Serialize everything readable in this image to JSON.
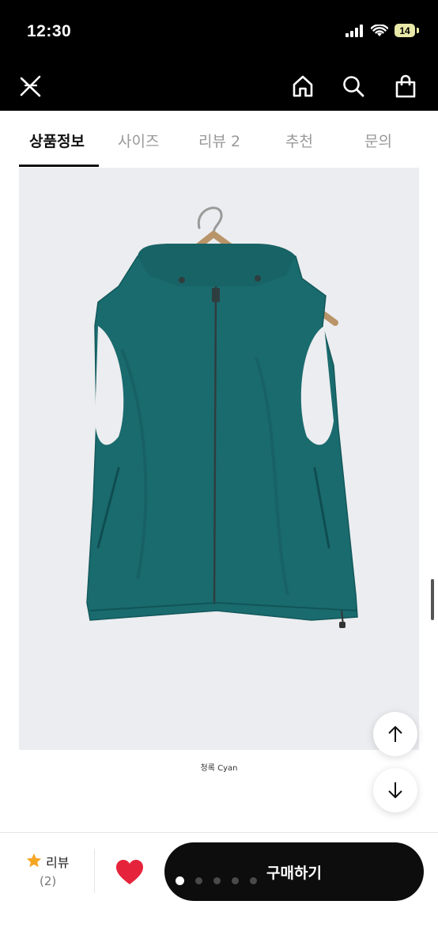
{
  "status": {
    "time": "12:30",
    "battery": "14"
  },
  "tabs": [
    {
      "label": "상품정보",
      "active": true
    },
    {
      "label": "사이즈",
      "active": false
    },
    {
      "label": "리뷰 2",
      "active": false
    },
    {
      "label": "추천",
      "active": false
    },
    {
      "label": "문의",
      "active": false
    }
  ],
  "product": {
    "caption": "청록 Cyan",
    "color_hex": "#1a6b6e"
  },
  "bottom": {
    "review_label": "리뷰",
    "review_count": "(2)",
    "buy_label": "구매하기"
  },
  "carousel": {
    "total_pages": 5,
    "current_page": 1
  },
  "colors": {
    "accent": "#0d0d0d",
    "star": "#f5a623",
    "heart": "#e5243b"
  }
}
